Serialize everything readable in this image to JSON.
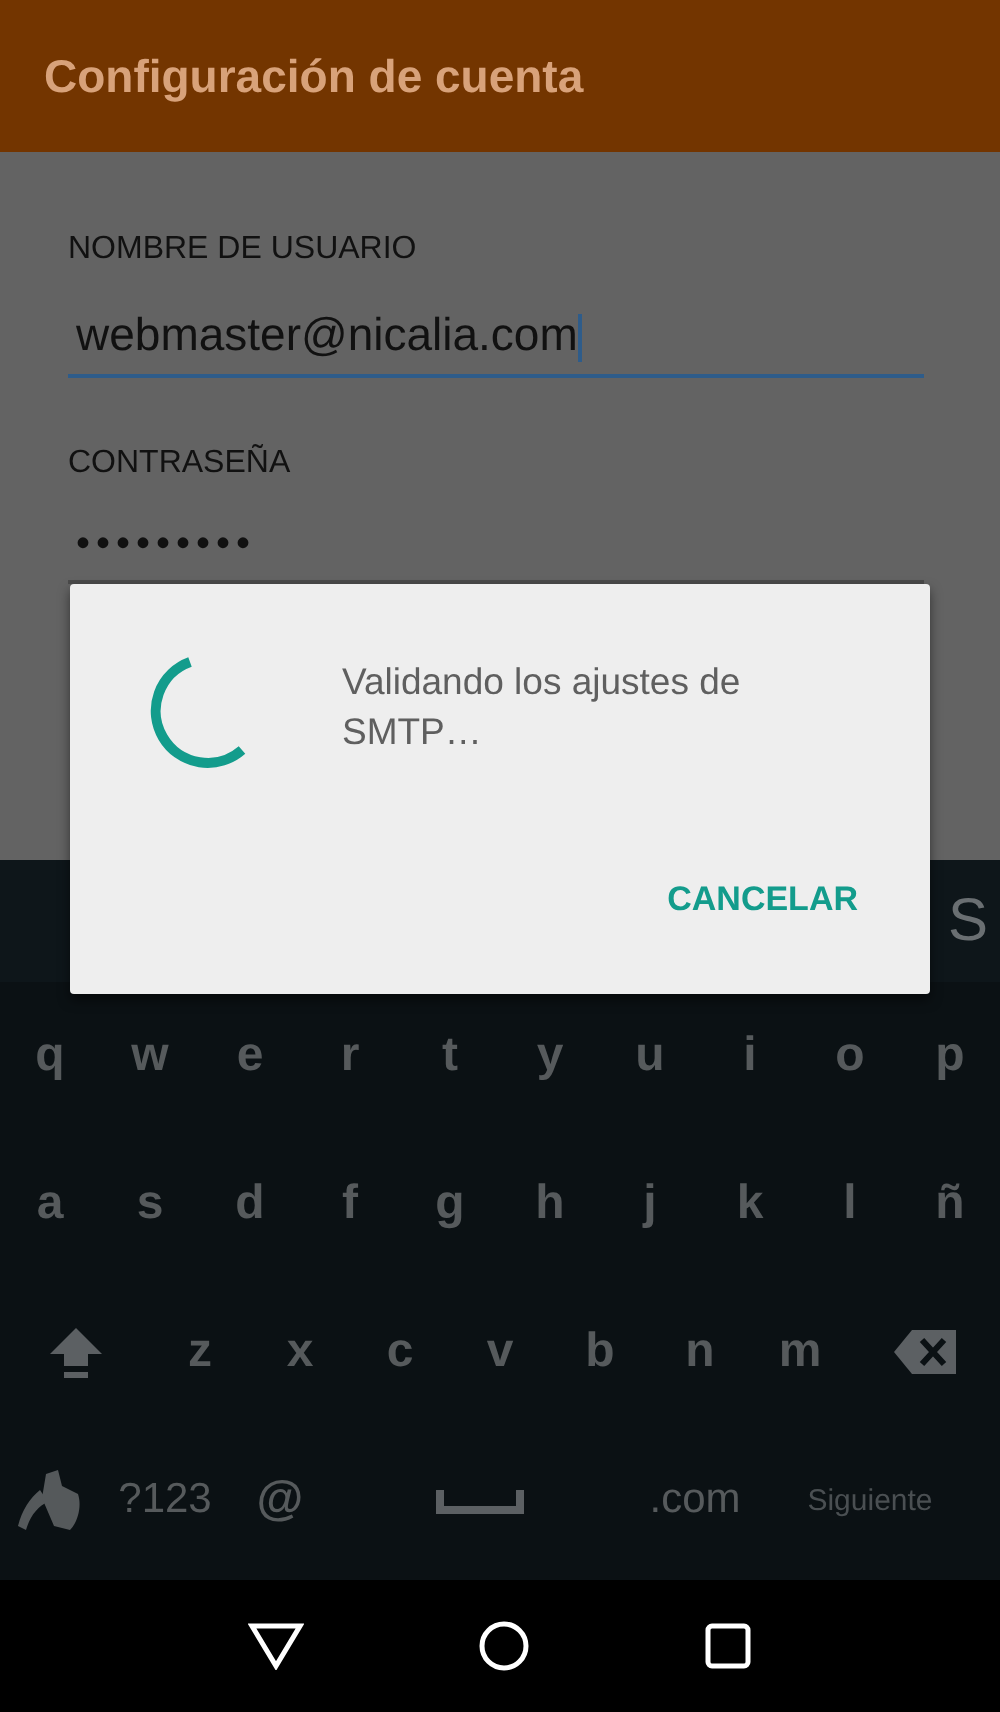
{
  "app_bar": {
    "title": "Configuración de cuenta"
  },
  "fields": [
    {
      "label": "NOMBRE DE USUARIO",
      "value": "webmaster@nicalia.com",
      "focused": true
    },
    {
      "label": "CONTRASEÑA",
      "value": "•••••••••",
      "focused": false
    }
  ],
  "dialog": {
    "message": "Validando los ajustes de SMTP…",
    "button": "CANCELAR"
  },
  "keyboard": {
    "suggestion": "S",
    "rows": [
      {
        "keys": [
          {
            "kind": "char",
            "label": "q"
          },
          {
            "kind": "char",
            "label": "w"
          },
          {
            "kind": "char",
            "label": "e"
          },
          {
            "kind": "char",
            "label": "r"
          },
          {
            "kind": "char",
            "label": "t"
          },
          {
            "kind": "char",
            "label": "y"
          },
          {
            "kind": "char",
            "label": "u"
          },
          {
            "kind": "char",
            "label": "i"
          },
          {
            "kind": "char",
            "label": "o"
          },
          {
            "kind": "char",
            "label": "p"
          }
        ]
      },
      {
        "keys": [
          {
            "kind": "char",
            "label": "a"
          },
          {
            "kind": "char",
            "label": "s"
          },
          {
            "kind": "char",
            "label": "d"
          },
          {
            "kind": "char",
            "label": "f"
          },
          {
            "kind": "char",
            "label": "g"
          },
          {
            "kind": "char",
            "label": "h"
          },
          {
            "kind": "char",
            "label": "j"
          },
          {
            "kind": "char",
            "label": "k"
          },
          {
            "kind": "char",
            "label": "l"
          },
          {
            "kind": "char",
            "label": "ñ"
          }
        ]
      },
      {
        "keys": [
          {
            "kind": "shift"
          },
          {
            "kind": "char",
            "label": "z"
          },
          {
            "kind": "char",
            "label": "x"
          },
          {
            "kind": "char",
            "label": "c"
          },
          {
            "kind": "char",
            "label": "v"
          },
          {
            "kind": "char",
            "label": "b"
          },
          {
            "kind": "char",
            "label": "n"
          },
          {
            "kind": "char",
            "label": "m"
          },
          {
            "kind": "backspace"
          }
        ]
      },
      {
        "keys": [
          {
            "kind": "gesture"
          },
          {
            "kind": "text",
            "label": "?123"
          },
          {
            "kind": "char",
            "label": "@"
          },
          {
            "kind": "space"
          },
          {
            "kind": "text",
            "label": ".com"
          },
          {
            "kind": "action",
            "label": "Siguiente"
          }
        ]
      }
    ]
  },
  "nav_bar": {
    "buttons": [
      {
        "kind": "back"
      },
      {
        "kind": "home"
      },
      {
        "kind": "recents"
      }
    ]
  }
}
